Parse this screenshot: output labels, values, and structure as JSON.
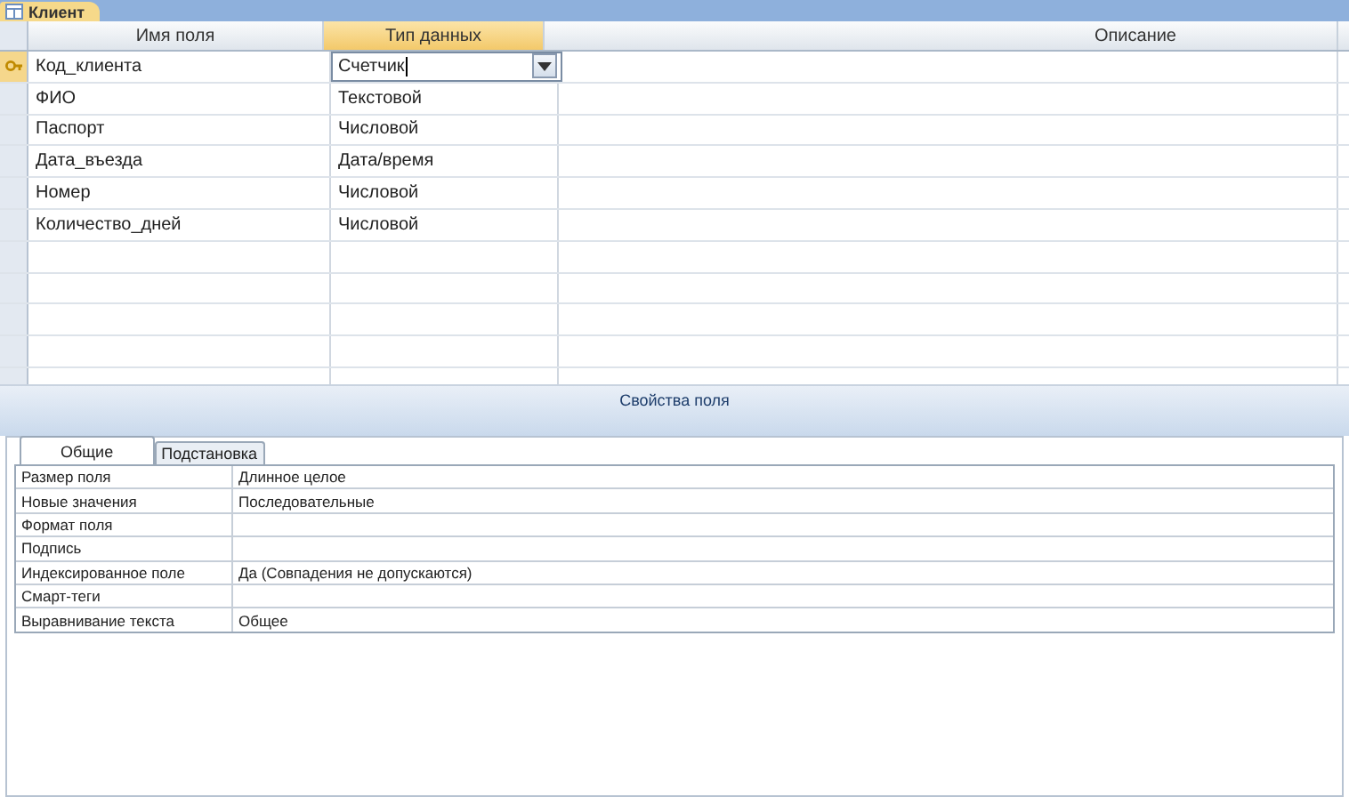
{
  "document_tab": {
    "title": "Клиент"
  },
  "columns": [
    "Имя поля",
    "Тип данных",
    "Описание"
  ],
  "fields": [
    {
      "name": "Код_клиента",
      "type": "Счетчик",
      "selected": true
    },
    {
      "name": "ФИО",
      "type": "Текстовой",
      "selected": false
    },
    {
      "name": "Паспорт",
      "type": "Числовой",
      "selected": false
    },
    {
      "name": "Дата_въезда",
      "type": "Дата/время",
      "selected": false
    },
    {
      "name": "Номер",
      "type": "Числовой",
      "selected": false
    },
    {
      "name": "Количество_дней",
      "type": "Числовой",
      "selected": false
    }
  ],
  "properties_title": "Свойства поля",
  "property_tabs": [
    {
      "label": "Общие",
      "selected": true
    },
    {
      "label": "Подстановка",
      "selected": false
    }
  ],
  "properties": [
    {
      "label": "Размер поля",
      "value": "Длинное целое"
    },
    {
      "label": "Новые значения",
      "value": "Последовательные"
    },
    {
      "label": "Формат поля"
    },
    {
      "label": "Подпись"
    },
    {
      "label": "Индексированное поле",
      "value": "Да (Совпадения не допускаются)"
    },
    {
      "label": "Смарт-теги"
    },
    {
      "label": "Выравнивание текста",
      "value": "Общее"
    }
  ]
}
